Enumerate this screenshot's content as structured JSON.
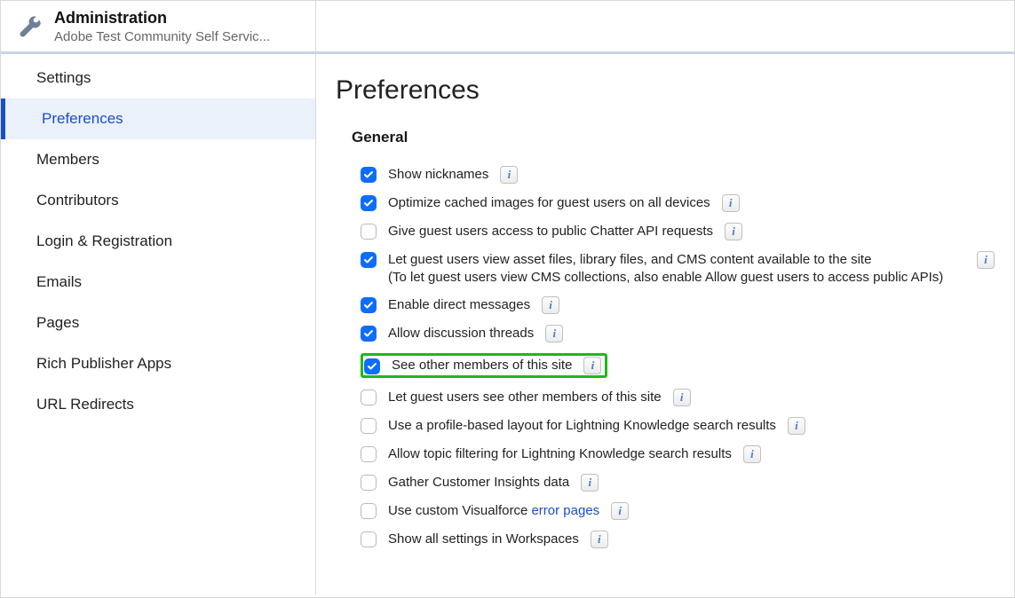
{
  "header": {
    "title": "Administration",
    "subtitle": "Adobe Test Community Self Servic..."
  },
  "sidebar": {
    "items": [
      {
        "label": "Settings",
        "active": false,
        "sub": false
      },
      {
        "label": "Preferences",
        "active": true,
        "sub": true
      },
      {
        "label": "Members",
        "active": false,
        "sub": false
      },
      {
        "label": "Contributors",
        "active": false,
        "sub": false
      },
      {
        "label": "Login & Registration",
        "active": false,
        "sub": false
      },
      {
        "label": "Emails",
        "active": false,
        "sub": false
      },
      {
        "label": "Pages",
        "active": false,
        "sub": false
      },
      {
        "label": "Rich Publisher Apps",
        "active": false,
        "sub": false
      },
      {
        "label": "URL Redirects",
        "active": false,
        "sub": false
      }
    ]
  },
  "main": {
    "title": "Preferences",
    "section": "General",
    "options": [
      {
        "checked": true,
        "label": "Show nicknames",
        "info": true
      },
      {
        "checked": true,
        "label": "Optimize cached images for guest users on all devices",
        "info": true
      },
      {
        "checked": false,
        "label": "Give guest users access to public Chatter API requests",
        "info": true
      },
      {
        "checked": true,
        "label": "Let guest users view asset files, library files, and CMS content available to the site",
        "subLabel": "(To let guest users view CMS collections, also enable Allow guest users to access public APIs)",
        "info": true,
        "infoFar": true
      },
      {
        "checked": true,
        "label": "Enable direct messages",
        "info": true
      },
      {
        "checked": true,
        "label": "Allow discussion threads",
        "info": true
      },
      {
        "checked": true,
        "label": "See other members of this site",
        "info": true,
        "highlight": true
      },
      {
        "checked": false,
        "label": "Let guest users see other members of this site",
        "info": true
      },
      {
        "checked": false,
        "label": "Use a profile-based layout for Lightning Knowledge search results",
        "info": true
      },
      {
        "checked": false,
        "label": "Allow topic filtering for Lightning Knowledge search results",
        "info": true
      },
      {
        "checked": false,
        "label": "Gather Customer Insights data",
        "info": true
      },
      {
        "checked": false,
        "label": "Use custom Visualforce ",
        "linkLabel": "error pages",
        "info": true
      },
      {
        "checked": false,
        "label": "Show all settings in Workspaces",
        "info": true
      }
    ]
  },
  "infoGlyph": "i"
}
